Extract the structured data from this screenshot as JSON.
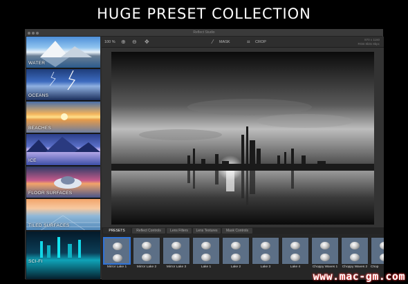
{
  "headline": "HUGE PRESET COLLECTION",
  "window": {
    "title": "Reflect Studio",
    "zoom": "100 %",
    "mask_label": "MASK",
    "crop_label": "CROP",
    "image_info_line1": "870 x 1160",
    "image_info_line2": "RGB 8bits 8bpc"
  },
  "sidebar": {
    "presets": [
      {
        "label": "WATER"
      },
      {
        "label": "OCEANS"
      },
      {
        "label": "BEACHES"
      },
      {
        "label": "ICE"
      },
      {
        "label": "FLOOR SURFACES"
      },
      {
        "label": "TILED SURFACES"
      },
      {
        "label": "SCI-FI"
      }
    ]
  },
  "tabs": [
    "PRESETS",
    "Reflect Controls",
    "Lens Filters",
    "Lens Textures",
    "Mask Controls"
  ],
  "thumbnails": [
    {
      "label": "Mirror Lake 1"
    },
    {
      "label": "Mirror Lake 2"
    },
    {
      "label": "Mirror Lake 3"
    },
    {
      "label": "Lake 1"
    },
    {
      "label": "Lake 2"
    },
    {
      "label": "Lake 3"
    },
    {
      "label": "Lake 4"
    },
    {
      "label": "Choppy Waves 1"
    },
    {
      "label": "Choppy Waves 2"
    },
    {
      "label": "Chop"
    }
  ],
  "watermark": "www.mac-gm.com",
  "colors": {
    "accent": "#2f73d8",
    "background": "#000000",
    "panel": "#2b2b2b"
  }
}
